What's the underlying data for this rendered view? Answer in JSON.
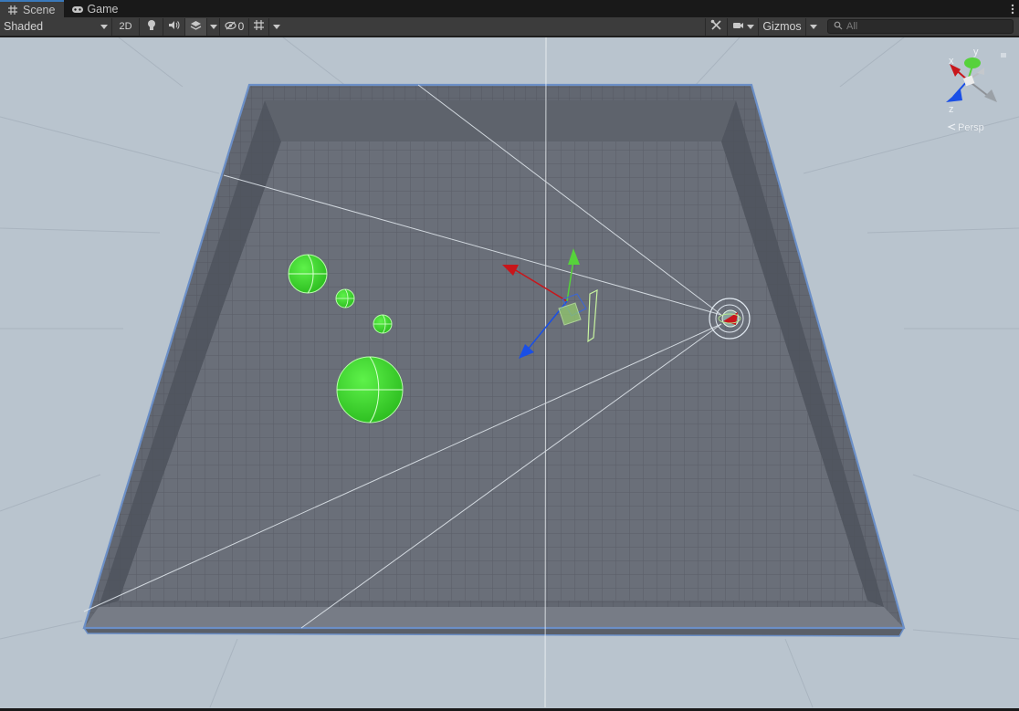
{
  "tabs": [
    {
      "label": "Scene",
      "icon": "grid-hash-icon",
      "active": true
    },
    {
      "label": "Game",
      "icon": "gamepad-icon",
      "active": false
    }
  ],
  "toolbar": {
    "shading_mode": "Shaded",
    "toggle_2d": "2D",
    "hidden_count": "0",
    "gizmos_label": "Gizmos",
    "search_placeholder": "All"
  },
  "scene_gizmo": {
    "axis_y": "y",
    "axis_x": "x",
    "axis_z": "z",
    "projection": "Persp"
  },
  "colors": {
    "viewport_background": "#b9c4ce",
    "floor": "#676c76",
    "selection_outline": "#6b8fc7",
    "sphere_green": "#3bd62e",
    "axis_x": "#c8161b",
    "axis_y": "#56d23b",
    "axis_z": "#1a4fe6",
    "accent_tab": "#3a79bb"
  }
}
